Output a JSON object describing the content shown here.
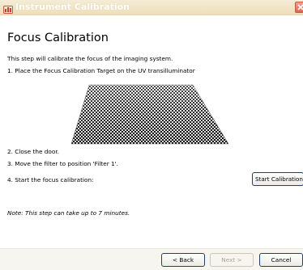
{
  "window": {
    "title": "Instrument Calibration"
  },
  "heading": "Focus Calibration",
  "intro": "This step will calibrate the focus of the imaging system.",
  "steps": {
    "step1": "1. Place the Focus Calibration Target on the UV transilluminator",
    "step2": "2. Close the door.",
    "step3": "3. Move the filter to position 'Filter 1'.",
    "step4": "4. Start the focus calibration:"
  },
  "start_button_label": "Start Calibration",
  "note": "Note: This step can take up to 7 minutes.",
  "footer": {
    "back_label": "< Back",
    "next_label": "Next >",
    "cancel_label": "Cancel"
  },
  "icons": {
    "app": "instrument-icon",
    "close": "close-icon",
    "target": "checkerboard-calibration-target-image"
  },
  "colors": {
    "titlebar": "#eedfb9",
    "title_text": "#ffffff",
    "close": "#e0664c",
    "footer": "#f6f5ef",
    "button_border": "#1f3f76"
  }
}
